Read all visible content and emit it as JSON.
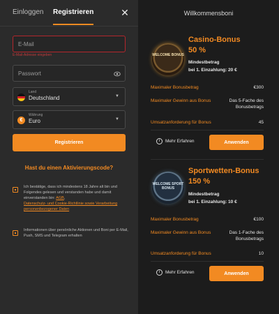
{
  "auth": {
    "tab_login": "Einloggen",
    "tab_register": "Registrieren",
    "email_placeholder": "E-Mail",
    "email_error": "E-Mail-Adresse eingeben",
    "password_placeholder": "Passwort",
    "country_label": "Land",
    "country_value": "Deutschland",
    "currency_label": "Währung",
    "currency_value": "Euro",
    "register_button": "Registrieren",
    "promo_link": "Hast du einen Aktivierungscode?",
    "consent1_prefix": "Ich bestätige, dass ich mindestens 18 Jahre alt bin und Folgendes gelesen und verstanden habe und damit einverstanden bin: ",
    "consent1_link1": "AGB",
    "consent1_link2": "Datenschutz- und Cookie-Richtlinie sowie Verarbeitung personenbezogener Daten",
    "consent2": "Informationen über persönliche Aktionen und Boni per E-Mail, Push, SMS und Telegram erhalten"
  },
  "bonuses": {
    "title": "Willkommensboni",
    "items": [
      {
        "badge": "WELCOME BONUS",
        "name": "Casino-Bonus",
        "percent": "50 %",
        "min_label": "Mindestbetrag",
        "min_value": "bei 1. Einzahlung: 20 €",
        "max_bonus_label": "Maximaler Bonusbetrag",
        "max_bonus_value": "€300",
        "max_win_label": "Maximaler Gewinn aus Bonus",
        "max_win_value": "Das 5-Fache des Bonusbetrags",
        "wager_label": "Umsatzanforderung für Bonus",
        "wager_value": "45",
        "more_label": "Mehr Erfahren",
        "apply_label": "Anwenden"
      },
      {
        "badge": "WELCOME SPORT BONUS",
        "name": "Sportwetten-Bonus",
        "percent": "150 %",
        "min_label": "Mindestbetrag",
        "min_value": "bei 1. Einzahlung: 10 €",
        "max_bonus_label": "Maximaler Bonusbetrag",
        "max_bonus_value": "€100",
        "max_win_label": "Maximaler Gewinn aus Bonus",
        "max_win_value": "Das 1-Fache des Bonusbetrags",
        "wager_label": "Umsatzanforderung für Bonus",
        "wager_value": "10",
        "more_label": "Mehr Erfahren",
        "apply_label": "Anwenden"
      }
    ]
  },
  "colors": {
    "accent": "#f28a22",
    "error": "#b3262c",
    "panel": "#2b2b2b",
    "background": "#1c1c1c"
  },
  "icons": {
    "close": "close-icon",
    "eye": "eye-icon",
    "info": "info-icon",
    "chevron": "chevron-down-icon"
  }
}
